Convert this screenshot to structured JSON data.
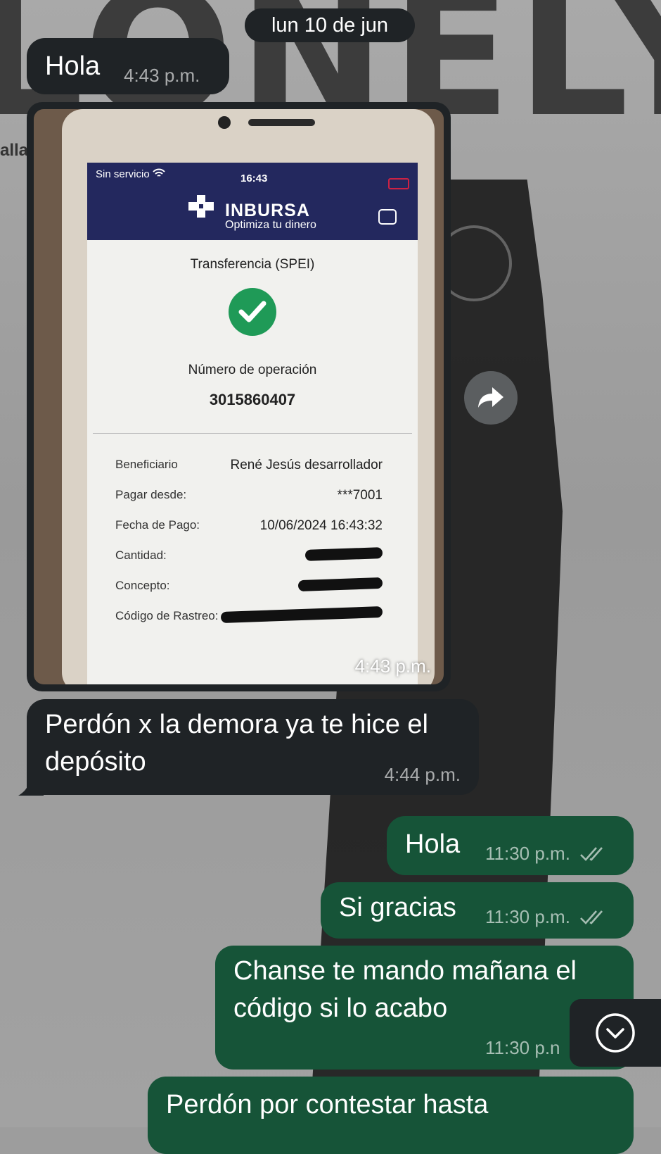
{
  "date_chip": "lun 10 de jun",
  "messages": [
    {
      "text": "Hola",
      "time": "4:43 p.m."
    },
    {
      "image_time": "4:43 p.m."
    },
    {
      "text": "Perdón x la demora ya te hice el depósito",
      "time": "4:44 p.m."
    },
    {
      "text": "Hola",
      "time": "11:30 p.m."
    },
    {
      "text": "Si gracias",
      "time": "11:30 p.m."
    },
    {
      "text": "Chanse te mando mañana el código si lo acabo",
      "time": "11:30 p.n"
    },
    {
      "text": "Perdón por contestar hasta"
    }
  ],
  "photo": {
    "status_carrier": "Sin servicio",
    "status_time": "16:43",
    "brand": "INBURSA",
    "tagline": "Optimiza tu dinero",
    "title": "Transferencia (SPEI)",
    "op_label": "Número de operación",
    "op_number": "3015860407",
    "rows": [
      {
        "label": "Beneficiario",
        "value": "René Jesús desarrollador"
      },
      {
        "label": "Pagar desde:",
        "value": "***7001"
      },
      {
        "label": "Fecha de Pago:",
        "value": "10/06/2024 16:43:32"
      },
      {
        "label": "Cantidad:",
        "value": ""
      },
      {
        "label": "Concepto:",
        "value": ""
      },
      {
        "label": "Código de Rastreo:",
        "value": ""
      }
    ]
  },
  "icons": {
    "forward": "forward-arrow-icon",
    "scroll_down": "chevron-down-circle-icon",
    "read_receipt": "double-check-icon",
    "success": "checkmark-icon"
  },
  "colors": {
    "incoming_bubble": "#1f2326",
    "outgoing_bubble": "#165438",
    "bank_header": "#23285e",
    "success_green": "#1f9a57"
  }
}
